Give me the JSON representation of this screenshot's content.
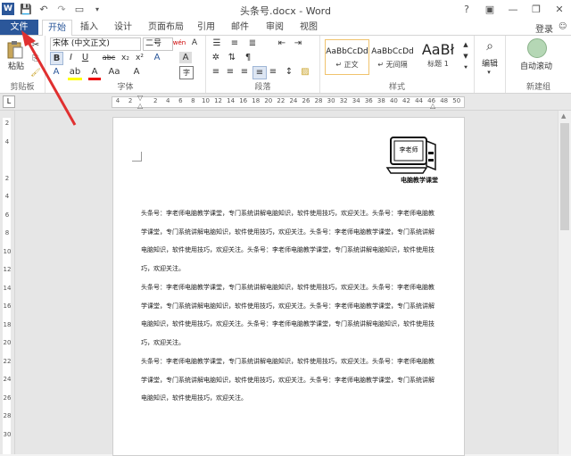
{
  "window": {
    "title": "头条号.docx - Word",
    "help": "?",
    "login": "登录"
  },
  "tabs": [
    {
      "label": "文件"
    },
    {
      "label": "开始"
    },
    {
      "label": "插入"
    },
    {
      "label": "设计"
    },
    {
      "label": "页面布局"
    },
    {
      "label": "引用"
    },
    {
      "label": "邮件"
    },
    {
      "label": "审阅"
    },
    {
      "label": "视图"
    }
  ],
  "ribbon": {
    "clipboard": {
      "label": "剪贴板",
      "paste": "粘贴"
    },
    "font": {
      "label": "字体",
      "name": "宋体 (中文正文)",
      "size": "二号",
      "wen": "wén",
      "big_a": "A",
      "bold": "B",
      "italic": "I",
      "underline": "U",
      "strike": "abc",
      "sub": "x₂",
      "sup": "x²"
    },
    "paragraph": {
      "label": "段落"
    },
    "styles": {
      "label": "样式",
      "items": [
        {
          "sample": "AaBbCcDd",
          "name": "↵ 正文"
        },
        {
          "sample": "AaBbCcDd",
          "name": "↵ 无间隔"
        },
        {
          "sample": "AaBł",
          "name": "标题 1"
        }
      ]
    },
    "editing": {
      "label": "编辑"
    },
    "new_group": {
      "label": "新建组",
      "autoscroll": "自动滚动"
    }
  },
  "ruler": {
    "h_ticks": [
      "4",
      "2",
      "",
      "2",
      "4",
      "6",
      "8",
      "10",
      "12",
      "14",
      "16",
      "18",
      "20",
      "22",
      "24",
      "26",
      "28",
      "30",
      "32",
      "34",
      "36",
      "38",
      "40",
      "42",
      "44",
      "46",
      "48",
      "50"
    ],
    "v_ticks": [
      "2",
      "4",
      "",
      "2",
      "4",
      "6",
      "8",
      "10",
      "12",
      "14",
      "16",
      "18",
      "20",
      "22",
      "24",
      "26",
      "28",
      "30"
    ]
  },
  "document": {
    "logo_sign": "李老师",
    "logo_caption": "电脑教学课堂",
    "paragraphs": [
      "头条号：李老师电脑教学课堂，专门系统讲解电脑知识，软件使用技巧，欢迎关注。头条号：李老师电脑教学课堂，专门系统讲解电脑知识，软件使用技巧，欢迎关注。头条号：李老师电脑教学课堂，专门系统讲解电脑知识，软件使用技巧，欢迎关注。头条号：李老师电脑教学课堂，专门系统讲解电脑知识，软件使用技巧，欢迎关注。",
      "头条号：李老师电脑教学课堂，专门系统讲解电脑知识，软件使用技巧，欢迎关注。头条号：李老师电脑教学课堂，专门系统讲解电脑知识，软件使用技巧，欢迎关注。头条号：李老师电脑教学课堂，专门系统讲解电脑知识，软件使用技巧，欢迎关注。头条号：李老师电脑教学课堂，专门系统讲解电脑知识，软件使用技巧，欢迎关注。",
      "头条号：李老师电脑教学课堂，专门系统讲解电脑知识，软件使用技巧，欢迎关注。头条号：李老师电脑教学课堂，专门系统讲解电脑知识，软件使用技巧，欢迎关注。头条号：李老师电脑教学课堂，专门系统讲解电脑知识，软件使用技巧，欢迎关注。"
    ]
  },
  "colors": {
    "accent": "#2b579a",
    "arrow": "#e03030"
  }
}
